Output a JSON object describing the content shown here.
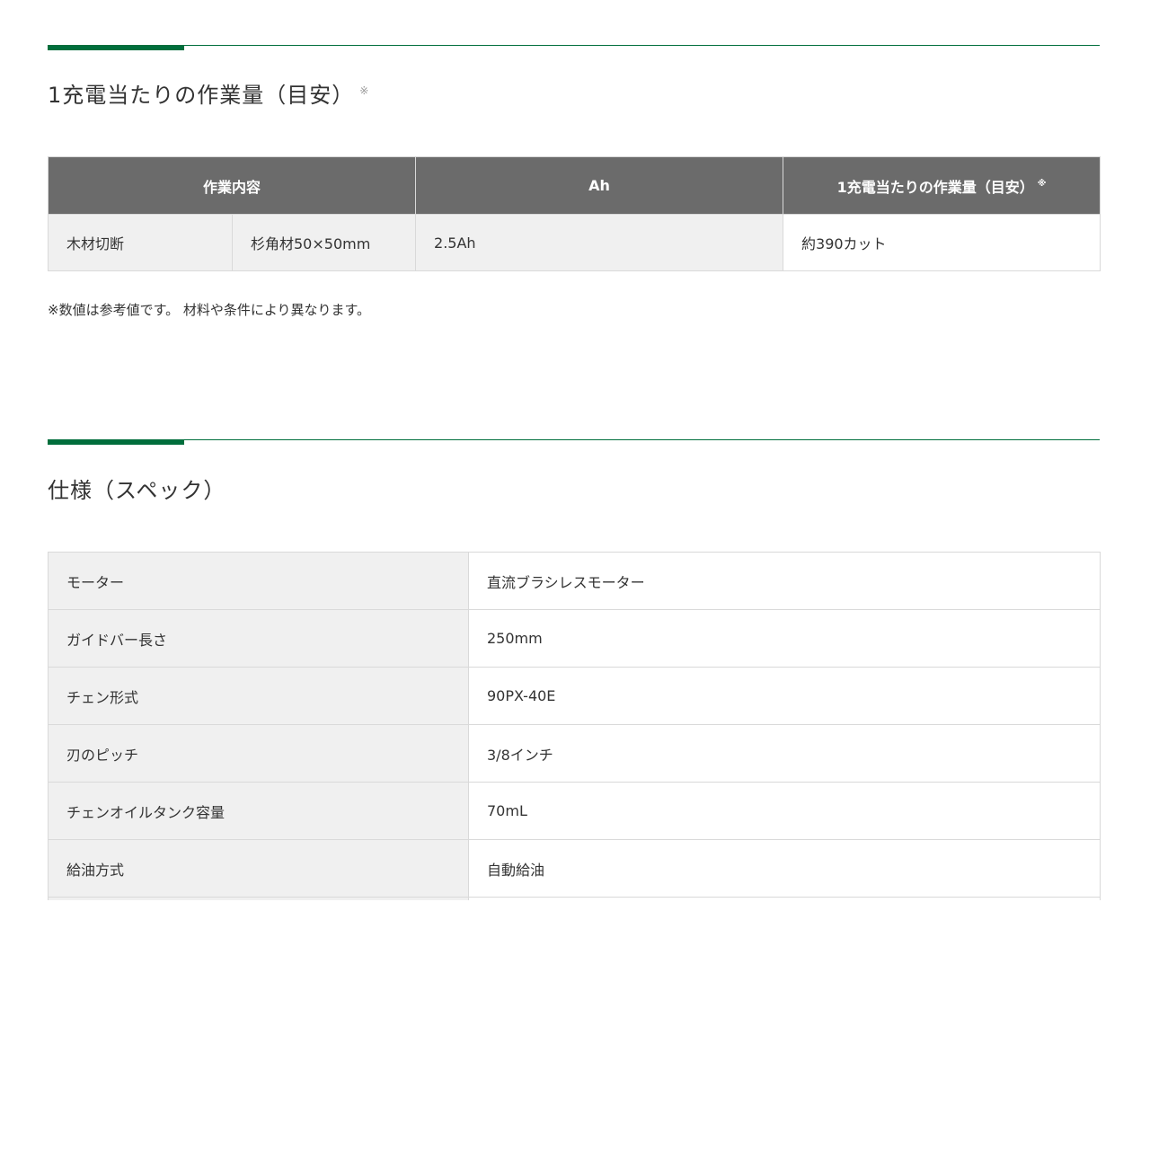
{
  "colors": {
    "accent": "#006e3c",
    "header_bg": "#6b6b6b"
  },
  "work_section": {
    "title": "1充電当たりの作業量（目安）",
    "title_mark": "※",
    "table": {
      "headers": [
        "作業内容",
        "Ah",
        "1充電当たりの作業量（目安）"
      ],
      "header_mark": "※",
      "rows": [
        {
          "task": "木材切断",
          "material": "杉角材50×50mm",
          "ah": "2.5Ah",
          "amount": "約390カット"
        }
      ]
    },
    "note": "※数値は参考値です。 材料や条件により異なります。"
  },
  "spec_section": {
    "title": "仕様（スペック）",
    "rows": [
      {
        "label": "モーター",
        "value": "直流ブラシレスモーター"
      },
      {
        "label": "ガイドバー長さ",
        "value": "250mm"
      },
      {
        "label": "チェン形式",
        "value": "90PX-40E"
      },
      {
        "label": "刃のピッチ",
        "value": "3/8インチ"
      },
      {
        "label": "チェンオイルタンク容量",
        "value": "70mL"
      },
      {
        "label": "給油方式",
        "value": "自動給油"
      }
    ]
  }
}
